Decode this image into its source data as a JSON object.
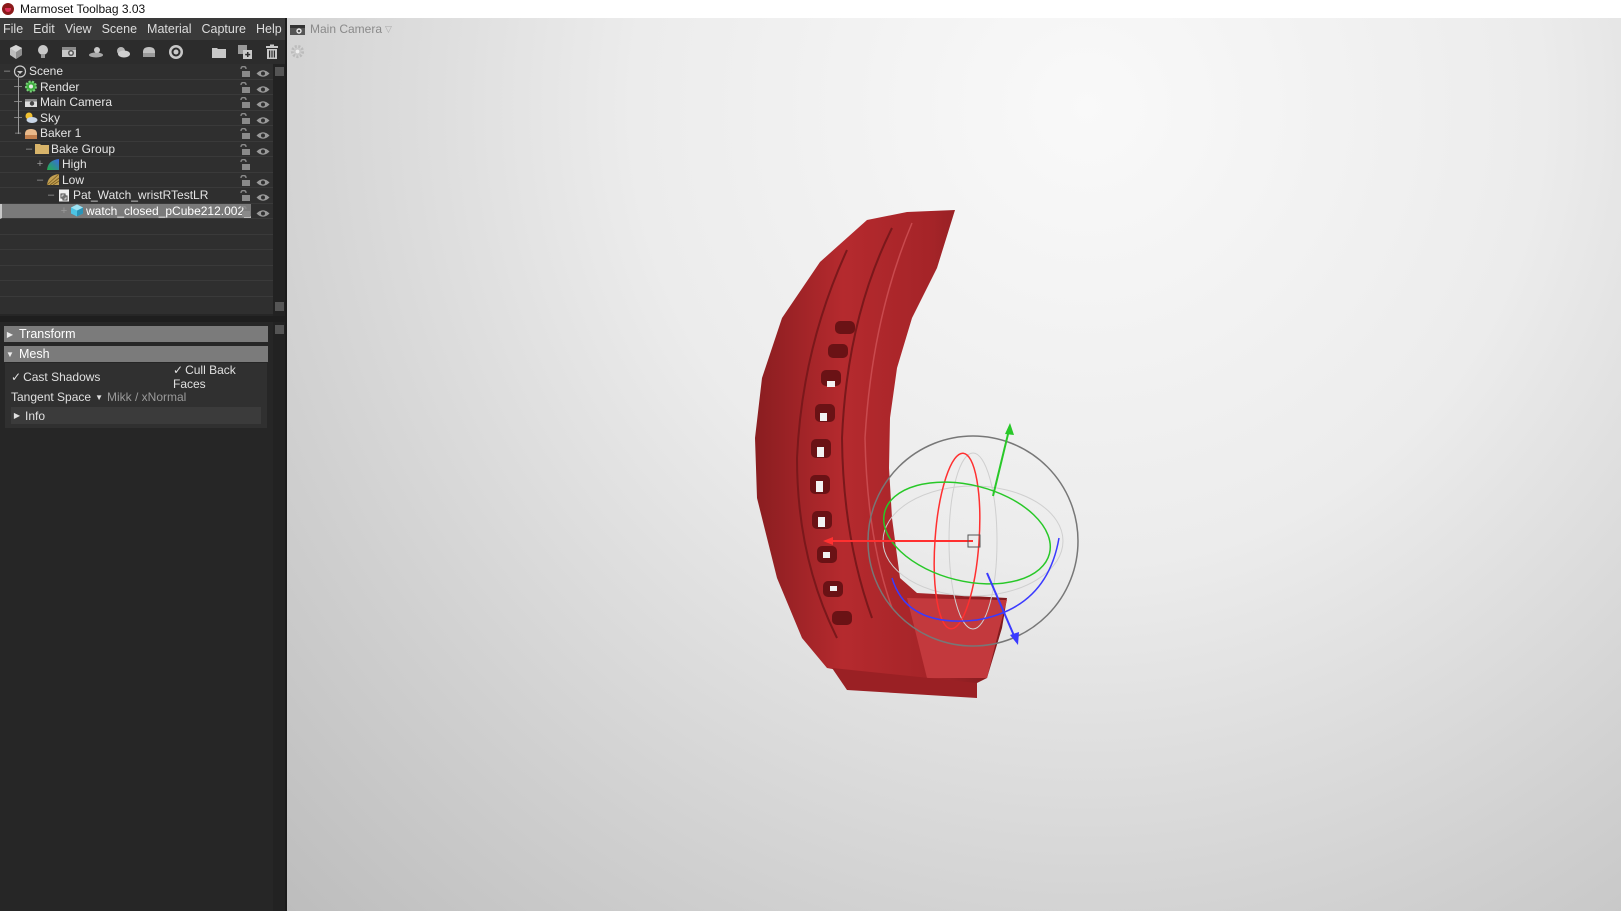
{
  "window": {
    "title": "Marmoset Toolbag 3.03"
  },
  "menu": {
    "items": [
      "File",
      "Edit",
      "View",
      "Scene",
      "Material",
      "Capture",
      "Help"
    ]
  },
  "toolbar": {
    "buttons": [
      {
        "name": "add-mesh",
        "icon": "cube-icon"
      },
      {
        "name": "add-light",
        "icon": "lightbulb-icon"
      },
      {
        "name": "add-camera",
        "icon": "camera-icon"
      },
      {
        "name": "add-turntable",
        "icon": "turntable-icon"
      },
      {
        "name": "add-sky",
        "icon": "sky-icon"
      },
      {
        "name": "add-baker",
        "icon": "baker-icon"
      },
      {
        "name": "add-shadow-catcher",
        "icon": "disc-icon"
      },
      {
        "name": "add-folder",
        "icon": "folder-icon"
      },
      {
        "name": "duplicate",
        "icon": "duplicate-icon"
      },
      {
        "name": "delete",
        "icon": "trash-icon"
      }
    ]
  },
  "scene_tree": {
    "items": [
      {
        "label": "Scene",
        "icon": "scene-icon",
        "depth": 0,
        "expander": "-",
        "lock": true,
        "visible": true,
        "selected": false
      },
      {
        "label": "Render",
        "icon": "render-gear-icon",
        "depth": 1,
        "expander": "",
        "lock": true,
        "visible": true,
        "selected": false
      },
      {
        "label": "Main Camera",
        "icon": "camera-icon",
        "depth": 1,
        "expander": "",
        "lock": true,
        "visible": true,
        "selected": false
      },
      {
        "label": "Sky",
        "icon": "sky-icon",
        "depth": 1,
        "expander": "",
        "lock": true,
        "visible": true,
        "selected": false
      },
      {
        "label": "Baker 1",
        "icon": "baker-icon",
        "depth": 1,
        "expander": "-",
        "lock": true,
        "visible": true,
        "selected": false
      },
      {
        "label": "Bake Group",
        "icon": "folder-icon",
        "depth": 2,
        "expander": "-",
        "lock": true,
        "visible": true,
        "selected": false
      },
      {
        "label": "High",
        "icon": "high-mesh-icon",
        "depth": 3,
        "expander": "+",
        "lock": true,
        "visible": false,
        "selected": false
      },
      {
        "label": "Low",
        "icon": "low-mesh-icon",
        "depth": 3,
        "expander": "-",
        "lock": true,
        "visible": true,
        "selected": false
      },
      {
        "label": "Pat_Watch_wristRTestLR",
        "icon": "file-icon",
        "depth": 4,
        "expander": "-",
        "lock": true,
        "visible": true,
        "selected": false
      },
      {
        "label": "watch_closed_pCube212.002_",
        "icon": "mesh-cube-icon",
        "depth": 5,
        "expander": "+",
        "lock": true,
        "visible": true,
        "selected": true
      }
    ]
  },
  "properties": {
    "sections": {
      "transform": {
        "label": "Transform",
        "expanded": false
      },
      "mesh": {
        "label": "Mesh",
        "expanded": true,
        "cast_shadows": {
          "label": "Cast Shadows",
          "checked": true
        },
        "cull_back_faces": {
          "label": "Cull Back Faces",
          "checked": true
        },
        "tangent_space": {
          "label": "Tangent Space",
          "value": "Mikk / xNormal"
        },
        "info": {
          "label": "Info",
          "expanded": false
        }
      }
    }
  },
  "viewport": {
    "camera_label": "Main Camera",
    "object_color": "#b52a2e",
    "gizmo": {
      "x_axis_color": "#ff3030",
      "y_axis_color": "#28c828",
      "z_axis_color": "#3a3aff"
    }
  }
}
